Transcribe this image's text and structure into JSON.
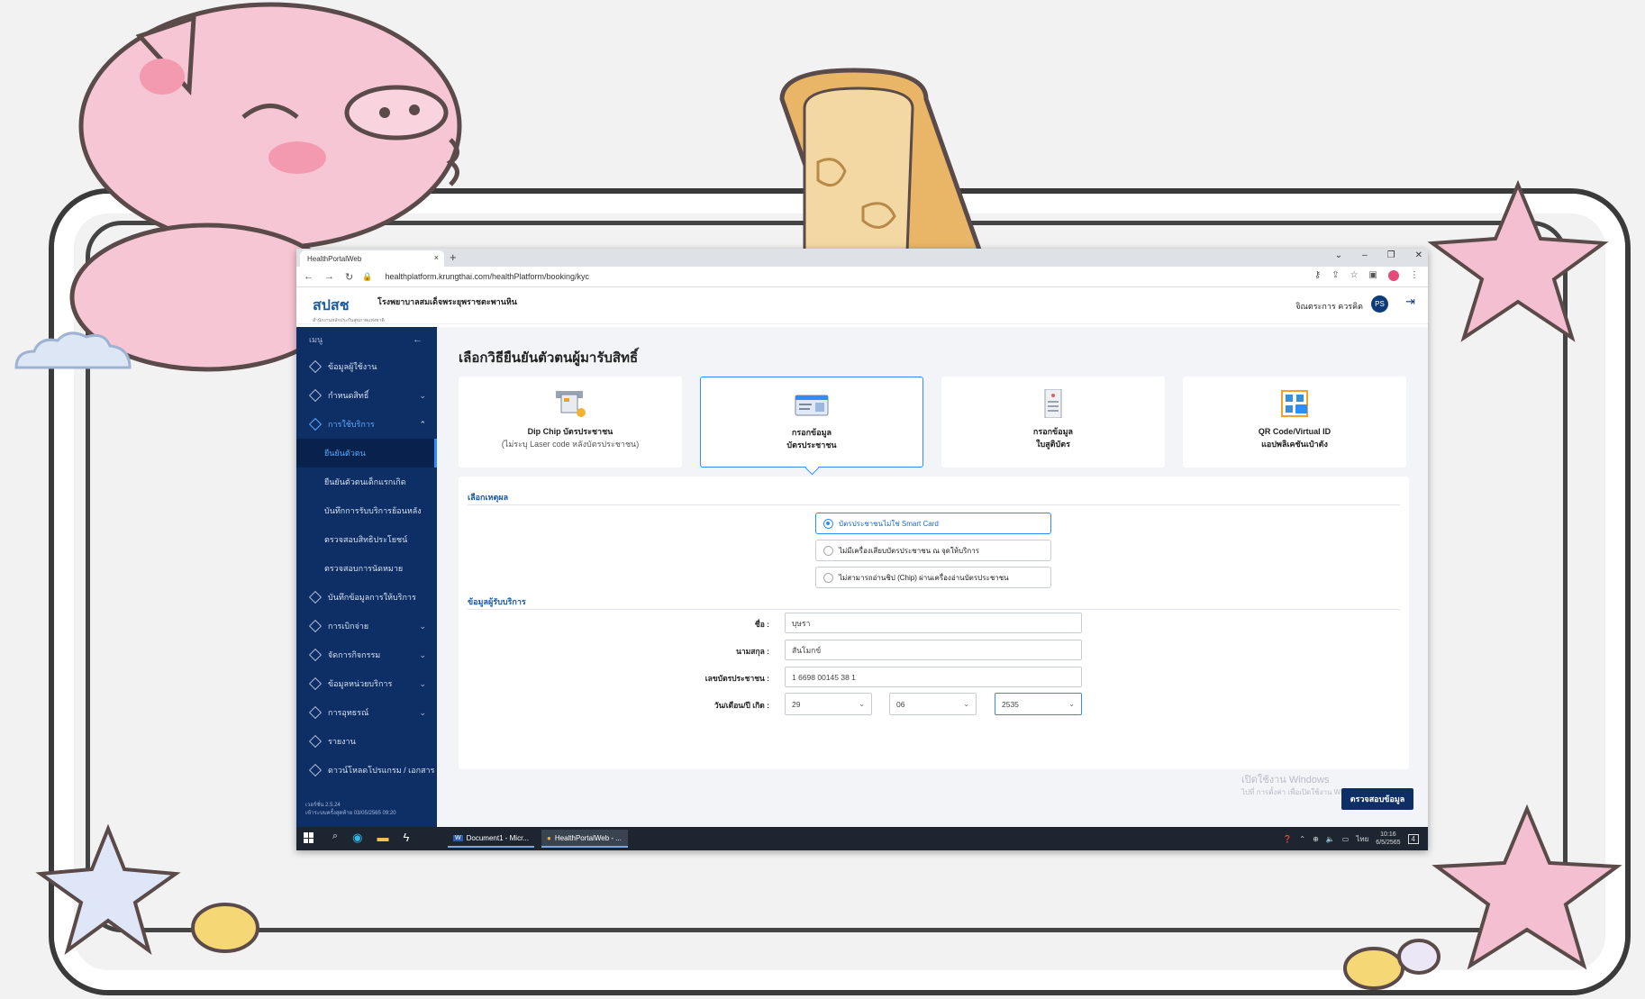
{
  "browser": {
    "tab_title": "HealthPortalWeb",
    "tab_close": "×",
    "new_tab": "+",
    "url": "healthplatform.krungthai.com/healthPlatform/booking/kyc"
  },
  "header": {
    "logo_text": "สปสช",
    "logo_sub": "สำนักงานหลักประกันสุขภาพแห่งชาติ",
    "hospital": "โรงพยาบาลสมเด็จพระยุพราชตะพานหิน",
    "user_name": "จิณตระการ ควรคิด",
    "avatar_initials": "PS"
  },
  "sidebar": {
    "title": "เมนู",
    "items": [
      {
        "label": "ข้อมูลผู้ใช้งาน"
      },
      {
        "label": "กำหนดสิทธิ์"
      },
      {
        "label": "การใช้บริการ"
      },
      {
        "label": "บันทึกข้อมูลการให้บริการ"
      },
      {
        "label": "การเบิกจ่าย"
      },
      {
        "label": "จัดการกิจกรรม"
      },
      {
        "label": "ข้อมูลหน่วยบริการ"
      },
      {
        "label": "การอุทธรณ์"
      },
      {
        "label": "รายงาน"
      },
      {
        "label": "ดาวน์โหลดโปรแกรม / เอกสาร"
      }
    ],
    "subitems": [
      {
        "label": "ยืนยันตัวตน"
      },
      {
        "label": "ยืนยันตัวตนเด็กแรกเกิด"
      },
      {
        "label": "บันทึกการรับบริการย้อนหลัง"
      },
      {
        "label": "ตรวจสอบสิทธิประโยชน์"
      },
      {
        "label": "ตรวจสอบการนัดหมาย"
      }
    ],
    "version": "เวอร์ชั่น 2.5.24",
    "last_login": "เข้าระบบครั้งสุดท้าย 03/05/2565 09:20"
  },
  "page": {
    "title": "เลือกวิธียืนยันตัวตนผู้มารับสิทธิ์",
    "methods": [
      {
        "line1": "Dip Chip บัตรประชาชน",
        "line2": "(ไม่ระบุ Laser code หลังบัตรประชาชน)"
      },
      {
        "line1": "กรอกข้อมูล",
        "line2": "บัตรประชาชน"
      },
      {
        "line1": "กรอกข้อมูล",
        "line2": "ใบสูติบัตร"
      },
      {
        "line1": "QR Code/Virtual ID",
        "line2": "แอปพลิเคชันเป๋าตัง"
      }
    ],
    "reason_title": "เลือกเหตุผล",
    "reasons": [
      "บัตรประชาชนไม่ใช่ Smart Card",
      "ไม่มีเครื่องเสียบบัตรประชาชน ณ จุดให้บริการ",
      "ไม่สามารถอ่านชิป (Chip) ผ่านเครื่องอ่านบัตรประชาชน"
    ],
    "patient_title": "ข้อมูลผู้รับบริการ",
    "fields": {
      "first_name_label": "ชื่อ :",
      "first_name": "บุษรา",
      "last_name_label": "นามสกุล :",
      "last_name": "สันโมกข์",
      "id_label": "เลขบัตรประชาชน :",
      "id_number": "1 6698 00145 38 1",
      "dob_label": "วัน/เดือน/ปี เกิด :",
      "dob_day": "29",
      "dob_month": "06",
      "dob_year": "2535"
    },
    "submit": "ตรวจสอบข้อมูล",
    "watermark_line1": "เปิดใช้งาน Windows",
    "watermark_line2": "ไปที่ การตั้งค่า เพื่อเปิดใช้งาน Windows"
  },
  "taskbar": {
    "app_word": "Document1 - Micr...",
    "app_chrome": "HealthPortalWeb - ...",
    "lang": "ไทย",
    "time": "10:16",
    "date": "6/5/2565",
    "notif_count": "4"
  },
  "colors": {
    "sidebar_bg": "#0e2f66",
    "accent": "#2f8cff",
    "primary_button": "#0e2f66"
  }
}
